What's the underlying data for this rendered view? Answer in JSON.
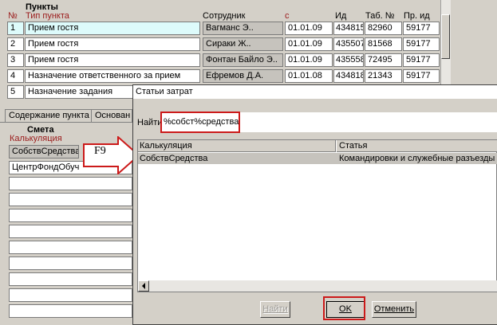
{
  "punkty": {
    "title": "Пункты",
    "headers": {
      "num": "№",
      "type": "Тип пункта",
      "employee": "Сотрудник",
      "from": "с",
      "id": "Ид",
      "tab": "Таб. №",
      "prid": "Пр. ид"
    },
    "rows": [
      {
        "num": "1",
        "type": "Прием гостя",
        "employee": "Вагманс Э..",
        "from": "01.01.09",
        "id": "434815",
        "tab": "82960",
        "prid": "59177"
      },
      {
        "num": "2",
        "type": "Прием гостя",
        "employee": "Сираки Ж..",
        "from": "01.01.09",
        "id": "435507",
        "tab": "81568",
        "prid": "59177"
      },
      {
        "num": "3",
        "type": "Прием гостя",
        "employee": "Фонтан Байло Э..",
        "from": "01.01.09",
        "id": "435558",
        "tab": "72495",
        "prid": "59177"
      },
      {
        "num": "4",
        "type": "Назначение ответственного за прием",
        "employee": "Ефремов Д.А.",
        "from": "01.01.08",
        "id": "434818",
        "tab": "21343",
        "prid": "59177"
      },
      {
        "num": "5",
        "type": "Назначение задания",
        "employee": "",
        "from": "",
        "id": "",
        "tab": "",
        "prid": ""
      }
    ]
  },
  "tabs": [
    "Содержание пункта",
    "Основан"
  ],
  "smeta": {
    "title": "Смета",
    "column": "Калькуляция",
    "rows": [
      "СобствСредства",
      "ЦентрФондОбуч",
      "",
      "",
      "",
      "",
      "",
      "",
      "",
      ""
    ]
  },
  "annotation": {
    "key": "F9"
  },
  "dialog": {
    "title": "Статьи затрат",
    "find_label": "Найти",
    "find_value": "%собст%средства",
    "columns": [
      "Калькуляция",
      "Статья"
    ],
    "rows": [
      {
        "calc": "СобствСредства",
        "article": "Командировки и служебные разъезды"
      }
    ],
    "buttons": {
      "find": "Найти",
      "ok": "OK",
      "cancel": "Отменить"
    }
  },
  "colors": {
    "selected_row": "#ddfbfb",
    "highlight_frame": "#cc1a1a",
    "column_header": "#9b1b1b",
    "result_row": "#c6c3bd"
  }
}
